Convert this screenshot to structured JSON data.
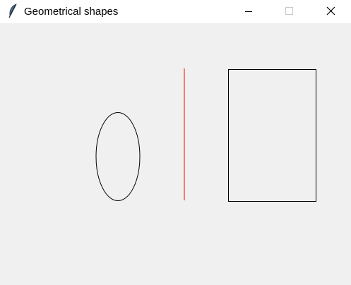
{
  "window": {
    "title": "Geometrical shapes",
    "app_icon": "feather-icon",
    "controls": [
      "minimize-icon",
      "maximize-icon",
      "close-icon"
    ]
  },
  "canvas": {
    "background": "#f0f0f0",
    "shapes": [
      {
        "type": "oval",
        "outline": "#000000"
      },
      {
        "type": "line",
        "stroke": "#ff0000"
      },
      {
        "type": "rectangle",
        "outline": "#000000"
      }
    ]
  }
}
